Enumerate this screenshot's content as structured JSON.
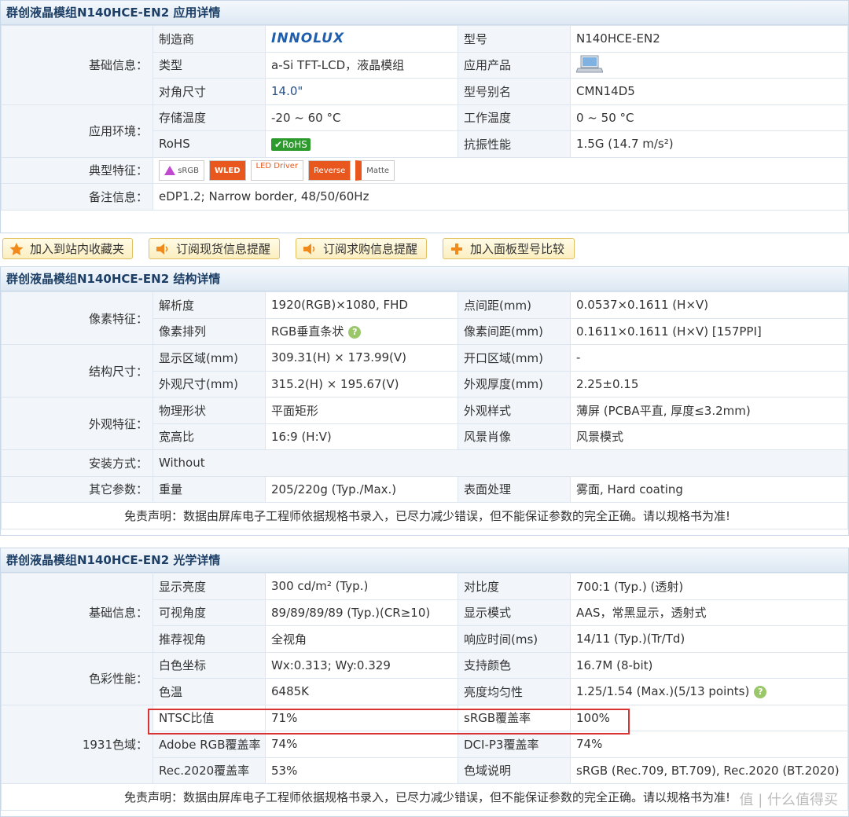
{
  "app": {
    "sections": [
      {
        "title": "群创液晶模组N140HCE-EN2 应用详情"
      },
      {
        "title": "群创液晶模组N140HCE-EN2 结构详情"
      },
      {
        "title": "群创液晶模组N140HCE-EN2 光学详情"
      }
    ]
  },
  "app_detail": {
    "basic_label": "基础信息：",
    "mfr_label": "制造商",
    "mfr_logo": "INNOLUX",
    "model_label": "型号",
    "model_value": "N140HCE-EN2",
    "type_label": "类型",
    "type_value": "a-Si TFT-LCD，液晶模组",
    "app_label": "应用产品",
    "diag_label": "对角尺寸",
    "diag_value": "14.0\"",
    "alias_label": "型号别名",
    "alias_value": "CMN14D5",
    "env_label": "应用环境：",
    "store_label": "存储温度",
    "store_value": "-20 ~ 60 °C",
    "work_label": "工作温度",
    "work_value": "0 ~ 50 °C",
    "rohs_label": "RoHS",
    "rohs_badge": "RoHS",
    "vib_label": "抗振性能",
    "vib_value": "1.5G (14.7 m/s²)",
    "feat_label": "典型特征：",
    "features": [
      "sRGB",
      "WLED",
      "LED Driver",
      "Reverse",
      "Matte"
    ],
    "note_label": "备注信息：",
    "note_value": "eDP1.2; Narrow border, 48/50/60Hz"
  },
  "buttons": {
    "fav": "加入到站内收藏夹",
    "stock": "订阅现货信息提醒",
    "buy": "订阅求购信息提醒",
    "compare": "加入面板型号比较"
  },
  "struct": {
    "pixel_label": "像素特征：",
    "res_label": "解析度",
    "res_value": "1920(RGB)×1080, FHD",
    "pitch_label": "点间距(mm)",
    "pitch_value": "0.0537×0.1611 (H×V)",
    "arr_label": "像素排列",
    "arr_value": "RGB垂直条状",
    "pp_label": "像素间距(mm)",
    "pp_value": "0.1611×0.1611 (H×V)  [157PPI]",
    "size_label": "结构尺寸：",
    "area_label": "显示区域(mm)",
    "area_value": "309.31(H) × 173.99(V)",
    "open_label": "开口区域(mm)",
    "open_value": "-",
    "outline_label": "外观尺寸(mm)",
    "outline_value": "315.2(H) × 195.67(V)",
    "thick_label": "外观厚度(mm)",
    "thick_value": "2.25±0.15",
    "look_label": "外观特征：",
    "shape_label": "物理形状",
    "shape_value": "平面矩形",
    "style_label": "外观样式",
    "style_value": "薄屏 (PCBA平直, 厚度≤3.2mm)",
    "ratio_label": "宽高比",
    "ratio_value": "16:9 (H:V)",
    "orient_label": "风景肖像",
    "orient_value": "风景模式",
    "mount_label": "安装方式：",
    "mount_value": "Without",
    "other_label": "其它参数：",
    "weight_label": "重量",
    "weight_value": "205/220g (Typ./Max.)",
    "surface_label": "表面处理",
    "surface_value": "雾面, Hard coating",
    "disclaimer": "免责声明：数据由屏库电子工程师依据规格书录入，已尽力减少错误，但不能保证参数的完全正确。请以规格书为准!"
  },
  "optic": {
    "basic_label": "基础信息：",
    "bright_label": "显示亮度",
    "bright_value": "300 cd/m² (Typ.)",
    "contrast_label": "对比度",
    "contrast_value": "700:1 (Typ.) (透射)",
    "view_label": "可视角度",
    "view_value": "89/89/89/89 (Typ.)(CR≥10)",
    "mode_label": "显示模式",
    "mode_value": "AAS，常黑显示，透射式",
    "rec_label": "推荐视角",
    "rec_value": "全视角",
    "resp_label": "响应时间(ms)",
    "resp_value": "14/11 (Typ.)(Tr/Td)",
    "color_label": "色彩性能：",
    "white_label": "白色坐标",
    "white_value": "Wx:0.313; Wy:0.329",
    "colors_label": "支持颜色",
    "colors_value": "16.7M (8-bit)",
    "temp_label": "色温",
    "temp_value": "6485K",
    "uni_label": "亮度均匀性",
    "uni_value": "1.25/1.54 (Max.)(5/13 points)",
    "gamut_label": "1931色域：",
    "ntsc_label": "NTSC比值",
    "ntsc_value": "71%",
    "srgb_label": "sRGB覆盖率",
    "srgb_value": "100%",
    "adobe_label": "Adobe RGB覆盖率",
    "adobe_value": "74%",
    "dci_label": "DCI-P3覆盖率",
    "dci_value": "74%",
    "rec2020_label": "Rec.2020覆盖率",
    "rec2020_value": "53%",
    "gdesc_label": "色域说明",
    "gdesc_value": "sRGB (Rec.709, BT.709), Rec.2020 (BT.2020)",
    "disclaimer": "免责声明：数据由屏库电子工程师依据规格书录入，已尽力减少错误，但不能保证参数的完全正确。请以规格书为准!"
  },
  "watermark": "值 | 什么值得买",
  "colors": {
    "header_text": "#1d3f66",
    "label_bg": "#f2f6fa",
    "highlight": "#d93434"
  }
}
